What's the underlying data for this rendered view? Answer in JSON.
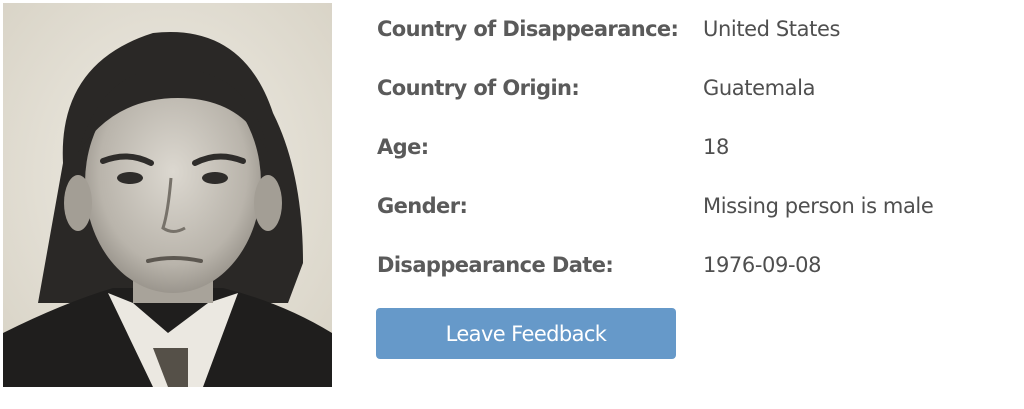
{
  "person": {
    "fields": [
      {
        "label": "Country of Disappearance:",
        "value": "United States"
      },
      {
        "label": "Country of Origin:",
        "value": "Guatemala"
      },
      {
        "label": "Age:",
        "value": "18"
      },
      {
        "label": "Gender:",
        "value": "Missing person is male"
      },
      {
        "label": "Disappearance Date:",
        "value": "1976-09-08"
      }
    ]
  },
  "actions": {
    "feedback_label": "Leave Feedback"
  },
  "colors": {
    "button": "#6699c9",
    "label_text": "#5a5a5a",
    "value_text": "#4f4f4f"
  }
}
